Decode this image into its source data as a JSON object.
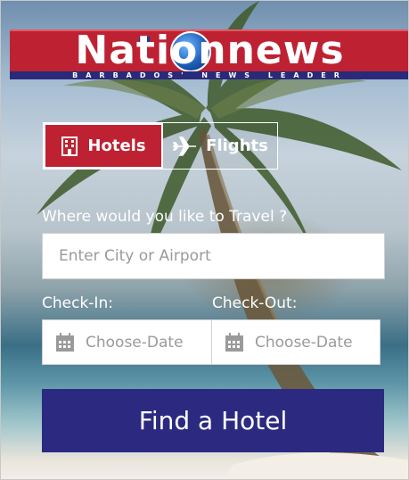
{
  "brand": {
    "logo_text": "Nationnews",
    "tagline": "BARBADOS' NEWS LEADER",
    "colors": {
      "red": "#be2232",
      "navy": "#2b2a80",
      "white": "#ffffff"
    }
  },
  "tabs": [
    {
      "label": "Hotels",
      "icon": "building-icon",
      "selected": true
    },
    {
      "label": "Flights",
      "icon": "airplane-icon",
      "selected": false
    }
  ],
  "search": {
    "destination_label": "Where would you like to Travel ?",
    "destination_placeholder": "Enter City or Airport",
    "checkin_label": "Check-In:",
    "checkout_label": "Check-Out:",
    "checkin_placeholder": "Choose-Date",
    "checkout_placeholder": "Choose-Date",
    "calendar_icon": "calendar-icon",
    "submit_label": "Find a Hotel"
  }
}
